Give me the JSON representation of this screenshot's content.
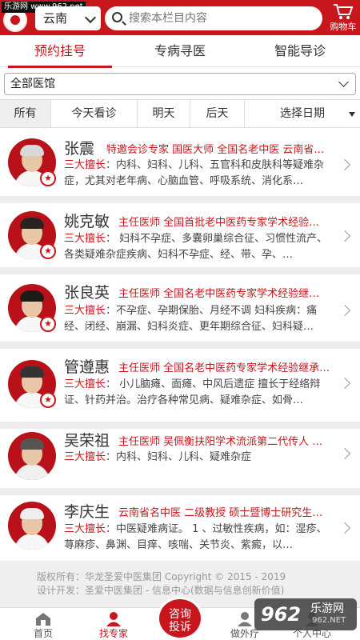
{
  "watermark_top": "乐游网 www.962.net",
  "header": {
    "region": "云南",
    "search_placeholder": "搜索本栏目内容",
    "cart_label": "购物车",
    "accent": "#c8161d"
  },
  "tabs": [
    {
      "label": "预约挂号",
      "active": true
    },
    {
      "label": "专病寻医",
      "active": false
    },
    {
      "label": "智能导诊",
      "active": false
    }
  ],
  "hospital_select": {
    "value": "全部医馆"
  },
  "day_filter": [
    {
      "label": "所有",
      "active": true
    },
    {
      "label": "今天看诊",
      "active": false
    },
    {
      "label": "明天",
      "active": false
    },
    {
      "label": "后天",
      "active": false
    },
    {
      "label": "选择日期",
      "active": false
    }
  ],
  "doctors": [
    {
      "name": "张震",
      "title": "特邀会诊专家 国医大师 全国名老中医 云南省…",
      "spec_key": "三大擅长",
      "spec": "：内科、妇科、儿科、五官科和皮肤科等疑难杂症，尤其对老年病、心脑血管、呼吸系统、消化系…"
    },
    {
      "name": "姚克敏",
      "title": "主任医师 全国首批老中医药专家学术经验…",
      "spec_key": "三大擅长",
      "spec": "： 妇科不孕症、多囊卵巢综合征、习惯性流产、各类疑难杂症疾病、妇科不孕症、经、带、孕、…"
    },
    {
      "name": "张良英",
      "title": "主任医师 全国名老中医药专家学术经验继…",
      "spec_key": "三大擅长",
      "spec": "：不孕症、孕期保胎、月经不调 妇科疾病：痛经、闭经、崩漏、妇科炎症、更年期综合征、妇科疑…"
    },
    {
      "name": "管遵惠",
      "title": "主任医师 全国名老中医药专家学术经验继承…",
      "spec_key": "三大擅长",
      "spec": "： 小儿脑瘫、面瘫、中风后遗症 擅长于经络辩证、针药并治。治疗各种常见病、疑难杂症、如骨…"
    },
    {
      "name": "吴荣祖",
      "title": "主任医师 吴佩衡扶阳学术流派第二代传人 …",
      "spec_key": "三大擅长",
      "spec": "：内科、妇科、儿科、疑难杂症"
    },
    {
      "name": "李庆生",
      "title": "云南省名中医 二级教授 硕士暨博士研究生…",
      "spec_key": "三大擅长",
      "spec": "：中医疑难病证。 1 、过敏性疾病，如：湿疹、荨麻疹、鼻渊、目痒、咳喘、关节炎、紫癜，以…"
    }
  ],
  "footer": {
    "copyright": "版权所有：华龙圣爱中医集团 Copyright © 2015 - 2019",
    "developer": "设计开发：圣爱中医集团 - 信息中心(数据与信息创新价值)"
  },
  "bottom_nav": [
    {
      "label": "首页",
      "icon": "home-icon"
    },
    {
      "label": "找专家",
      "icon": "doctor-icon"
    },
    {
      "label": "咨询\n投诉",
      "icon": "consult-button"
    },
    {
      "label": "做外疗",
      "icon": "treatment-icon"
    },
    {
      "label": "个人中心",
      "icon": "user-icon"
    }
  ],
  "watermark_bottom": {
    "brand": "962",
    "name": "乐游网",
    "url": "962.NET"
  }
}
